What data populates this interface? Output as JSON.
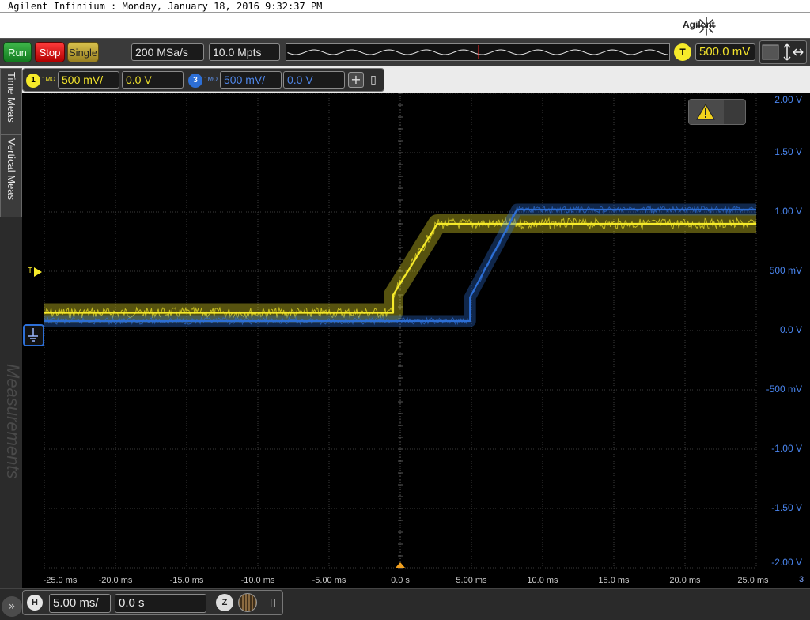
{
  "window": {
    "title": "Agilent Infiniium : Monday, January 18, 2016 9:32:37 PM"
  },
  "brand": {
    "name": "Agilent"
  },
  "toolbar": {
    "run_label": "Run",
    "stop_label": "Stop",
    "single_label": "Single",
    "sample_rate": "200 MSa/s",
    "memory_depth": "10.0 Mpts",
    "trigger_badge": "T",
    "trigger_level": "500.0 mV"
  },
  "channels": [
    {
      "badge": "1",
      "impedance": "1MΩ",
      "scale": "500 mV/",
      "offset": "0.0 V",
      "color": "#f6ea2a"
    },
    {
      "badge": "3",
      "impedance": "1MΩ",
      "scale": "500 mV/",
      "offset": "0.0 V",
      "color": "#2d6fd6"
    }
  ],
  "side_tabs": {
    "time_meas": "Time Meas",
    "vertical_meas": "Vertical Meas",
    "watermark": "Measurements"
  },
  "trigger_marker": "T",
  "y_axis_labels": [
    "2.00 V",
    "1.50 V",
    "1.00 V",
    "500 mV",
    "0.0 V",
    "-500 mV",
    "-1.00 V",
    "-1.50 V",
    "-2.00 V"
  ],
  "x_axis_labels": [
    "-25.0 ms",
    "-20.0 ms",
    "-15.0 ms",
    "-10.0 ms",
    "-5.00 ms",
    "0.0 s",
    "5.00 ms",
    "10.0 ms",
    "15.0 ms",
    "20.0 ms",
    "25.0 ms"
  ],
  "x_axis_corner": "3",
  "horizontal": {
    "badge": "H",
    "time_scale": "5.00 ms/",
    "position": "0.0 s",
    "zoom_badge": "Z"
  },
  "chart_data": {
    "type": "line",
    "x_unit": "ms",
    "y_unit": "V",
    "xlim": [
      -25,
      25
    ],
    "ylim": [
      -2,
      2
    ],
    "grid": true,
    "series": [
      {
        "channel": "1",
        "color": "#f6ea2a",
        "noise_band_v": 0.16,
        "points": [
          [
            -25,
            0.15
          ],
          [
            -0.5,
            0.15
          ],
          [
            -0.5,
            0.3
          ],
          [
            2.6,
            0.9
          ],
          [
            25,
            0.9
          ]
        ]
      },
      {
        "channel": "3",
        "color": "#2d6fd6",
        "noise_band_v": 0.1,
        "points": [
          [
            -25,
            0.08
          ],
          [
            4.9,
            0.08
          ],
          [
            4.9,
            0.28
          ],
          [
            8.2,
            1.02
          ],
          [
            25,
            1.02
          ]
        ]
      }
    ]
  }
}
